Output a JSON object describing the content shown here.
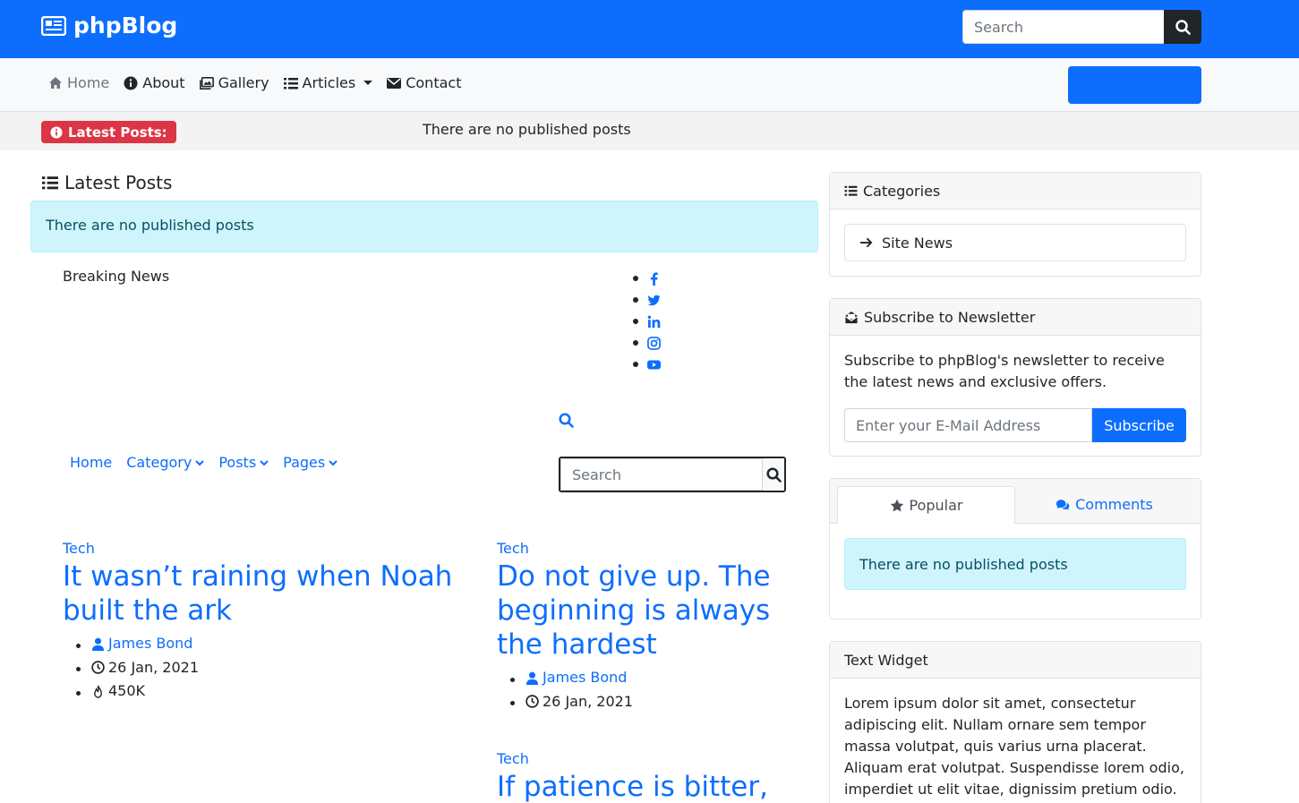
{
  "header": {
    "brand": "phpBlog",
    "search_placeholder": "Search"
  },
  "nav": {
    "items": [
      {
        "label": "Home",
        "icon": "home-icon"
      },
      {
        "label": "About",
        "icon": "info-circle-icon"
      },
      {
        "label": "Gallery",
        "icon": "images-icon"
      },
      {
        "label": "Articles",
        "icon": "list-icon"
      },
      {
        "label": "Contact",
        "icon": "envelope-icon"
      }
    ]
  },
  "ticker": {
    "badge": "Latest Posts:",
    "text": "There are no published posts"
  },
  "main": {
    "title": "Latest Posts",
    "alert": "There are no published posts",
    "breaking": "Breaking News",
    "subnav": [
      "Home",
      "Category",
      "Posts",
      "Pages"
    ],
    "search_placeholder": "Search",
    "posts": [
      {
        "category": "Tech",
        "title": "It wasn’t raining when Noah built the ark",
        "author": "James Bond",
        "date": "26 Jan, 2021",
        "views": "450K"
      },
      {
        "category": "Tech",
        "title": "Do not give up. The beginning is always the hardest",
        "author": "James Bond",
        "date": "26 Jan, 2021"
      },
      {
        "category": "Tech",
        "title": "If patience is bitter,"
      }
    ]
  },
  "sidebar": {
    "categories_title": "Categories",
    "category_item": "Site News",
    "newsletter_title": "Subscribe to Newsletter",
    "newsletter_text": "Subscribe to phpBlog's newsletter to receive the latest news and exclusive offers.",
    "email_placeholder": "Enter your E-Mail Address",
    "subscribe_label": "Subscribe",
    "tab_popular": "Popular",
    "tab_comments": "Comments",
    "popular_alert": "There are no published posts",
    "text_widget_title": "Text Widget",
    "text_widget_body": "Lorem ipsum dolor sit amet, consectetur adipiscing elit. Nullam ornare sem tempor massa volutpat, quis varius urna placerat. Aliquam erat volutpat. Suspendisse lorem odio, imperdiet ut elit vitae, dignissim pretium odio."
  },
  "colors": {
    "primary": "#0d6efd",
    "danger": "#dc3545",
    "info_bg": "#cff4fc",
    "dark": "#212529"
  }
}
